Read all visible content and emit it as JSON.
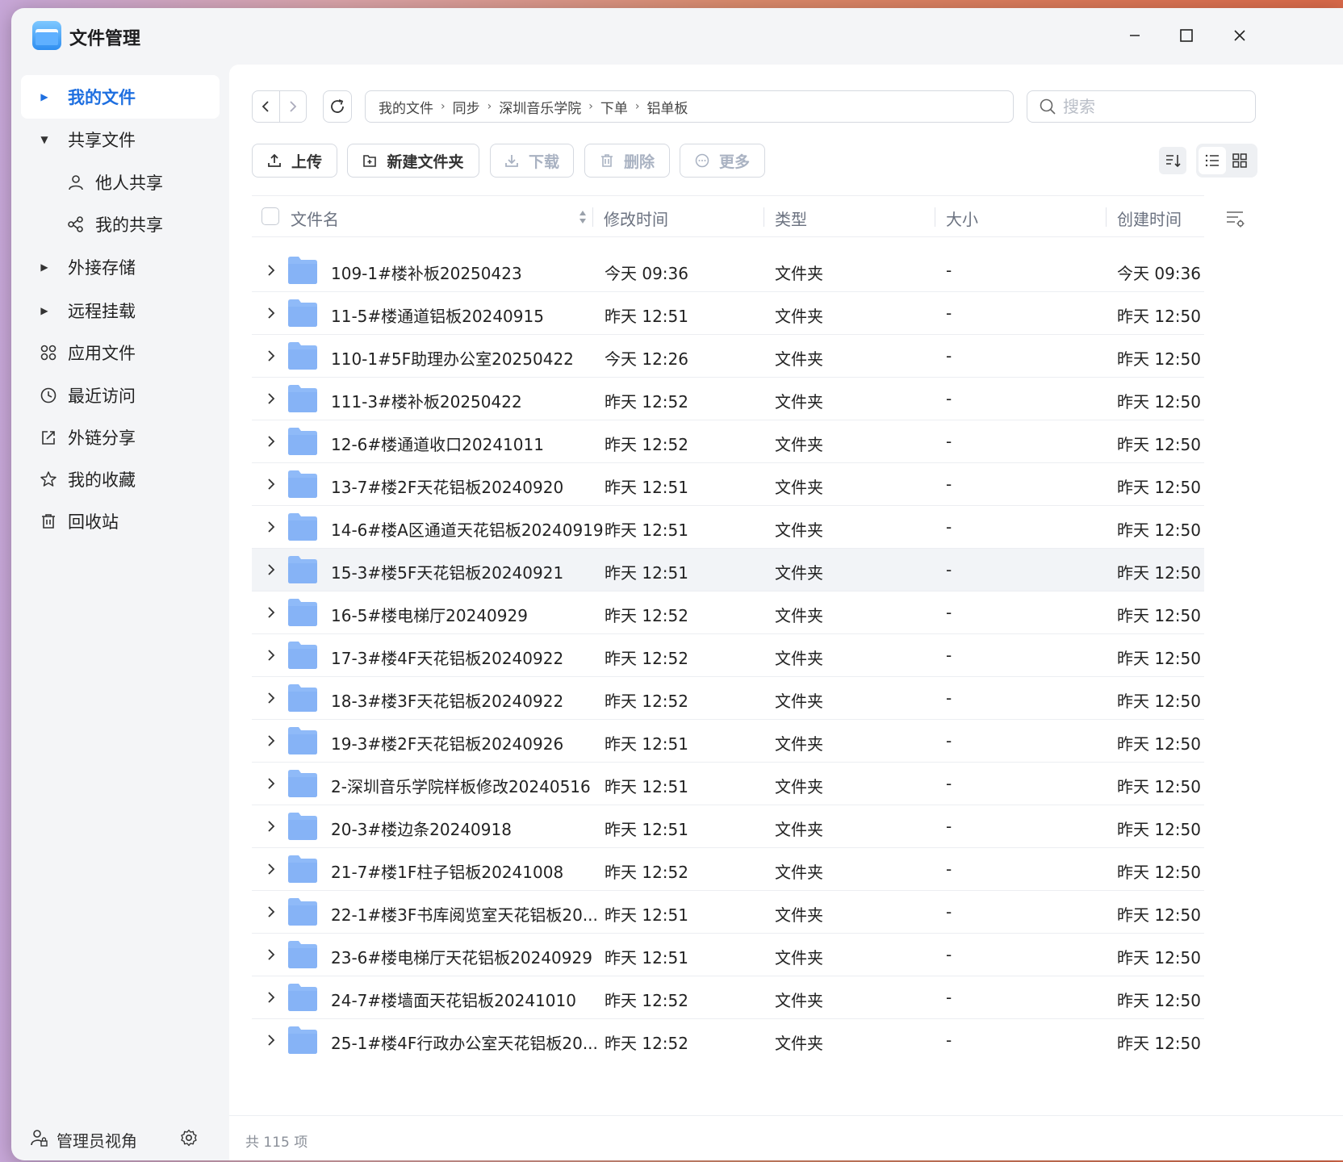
{
  "window": {
    "title": "文件管理",
    "controls": {
      "minimize": "—",
      "maximize": "☐",
      "close": "✕"
    }
  },
  "sidebar": {
    "items": [
      {
        "label": "我的文件",
        "icon": "caret-right-icon",
        "active": true
      },
      {
        "label": "共享文件",
        "icon": "caret-down-icon"
      },
      {
        "label": "他人共享",
        "icon": "user-icon",
        "sub": true
      },
      {
        "label": "我的共享",
        "icon": "share-icon",
        "sub": true
      },
      {
        "label": "外接存储",
        "icon": "caret-right-icon"
      },
      {
        "label": "远程挂载",
        "icon": "caret-right-icon"
      },
      {
        "label": "应用文件",
        "icon": "apps-icon"
      },
      {
        "label": "最近访问",
        "icon": "clock-icon"
      },
      {
        "label": "外链分享",
        "icon": "external-share-icon"
      },
      {
        "label": "我的收藏",
        "icon": "star-icon"
      },
      {
        "label": "回收站",
        "icon": "trash-icon"
      }
    ],
    "footer": {
      "label": "管理员视角",
      "icon": "admin-user-icon",
      "settings_icon": "gear-icon"
    }
  },
  "breadcrumb": [
    "我的文件",
    "同步",
    "深圳音乐学院",
    "下单",
    "铝单板"
  ],
  "search": {
    "placeholder": "搜索",
    "value": ""
  },
  "toolbar": {
    "upload": "上传",
    "new_folder": "新建文件夹",
    "download": "下载",
    "delete": "删除",
    "more": "更多"
  },
  "table": {
    "columns": {
      "name": "文件名",
      "mtime": "修改时间",
      "type": "类型",
      "size": "大小",
      "ctime": "创建时间"
    },
    "rows": [
      {
        "name": "109-1#楼补板20250423",
        "mtime": "今天 09:36",
        "type": "文件夹",
        "size": "-",
        "ctime": "今天 09:36"
      },
      {
        "name": "11-5#楼通道铝板20240915",
        "mtime": "昨天 12:51",
        "type": "文件夹",
        "size": "-",
        "ctime": "昨天 12:50"
      },
      {
        "name": "110-1#5F助理办公室20250422",
        "mtime": "今天 12:26",
        "type": "文件夹",
        "size": "-",
        "ctime": "昨天 12:50"
      },
      {
        "name": "111-3#楼补板20250422",
        "mtime": "昨天 12:52",
        "type": "文件夹",
        "size": "-",
        "ctime": "昨天 12:50"
      },
      {
        "name": "12-6#楼通道收口20241011",
        "mtime": "昨天 12:52",
        "type": "文件夹",
        "size": "-",
        "ctime": "昨天 12:50"
      },
      {
        "name": "13-7#楼2F天花铝板20240920",
        "mtime": "昨天 12:51",
        "type": "文件夹",
        "size": "-",
        "ctime": "昨天 12:50"
      },
      {
        "name": "14-6#楼A区通道天花铝板20240919",
        "mtime": "昨天 12:51",
        "type": "文件夹",
        "size": "-",
        "ctime": "昨天 12:50"
      },
      {
        "name": "15-3#楼5F天花铝板20240921",
        "mtime": "昨天 12:51",
        "type": "文件夹",
        "size": "-",
        "ctime": "昨天 12:50",
        "highlight": true
      },
      {
        "name": "16-5#楼电梯厅20240929",
        "mtime": "昨天 12:52",
        "type": "文件夹",
        "size": "-",
        "ctime": "昨天 12:50"
      },
      {
        "name": "17-3#楼4F天花铝板20240922",
        "mtime": "昨天 12:52",
        "type": "文件夹",
        "size": "-",
        "ctime": "昨天 12:50"
      },
      {
        "name": "18-3#楼3F天花铝板20240922",
        "mtime": "昨天 12:52",
        "type": "文件夹",
        "size": "-",
        "ctime": "昨天 12:50"
      },
      {
        "name": "19-3#楼2F天花铝板20240926",
        "mtime": "昨天 12:51",
        "type": "文件夹",
        "size": "-",
        "ctime": "昨天 12:50"
      },
      {
        "name": "2-深圳音乐学院样板修改20240516",
        "mtime": "昨天 12:51",
        "type": "文件夹",
        "size": "-",
        "ctime": "昨天 12:50"
      },
      {
        "name": "20-3#楼边条20240918",
        "mtime": "昨天 12:51",
        "type": "文件夹",
        "size": "-",
        "ctime": "昨天 12:50"
      },
      {
        "name": "21-7#楼1F柱子铝板20241008",
        "mtime": "昨天 12:52",
        "type": "文件夹",
        "size": "-",
        "ctime": "昨天 12:50"
      },
      {
        "name": "22-1#楼3F书库阅览室天花铝板20...",
        "mtime": "昨天 12:51",
        "type": "文件夹",
        "size": "-",
        "ctime": "昨天 12:50"
      },
      {
        "name": "23-6#楼电梯厅天花铝板20240929",
        "mtime": "昨天 12:51",
        "type": "文件夹",
        "size": "-",
        "ctime": "昨天 12:50"
      },
      {
        "name": "24-7#楼墙面天花铝板20241010",
        "mtime": "昨天 12:52",
        "type": "文件夹",
        "size": "-",
        "ctime": "昨天 12:50"
      },
      {
        "name": "25-1#楼4F行政办公室天花铝板20...",
        "mtime": "昨天 12:52",
        "type": "文件夹",
        "size": "-",
        "ctime": "昨天 12:50"
      }
    ]
  },
  "status": {
    "count_text": "共 115 项"
  },
  "colors": {
    "accent": "#1e6fe0",
    "folder": "#8fbaf8",
    "folder_dark": "#6ea3f2"
  }
}
